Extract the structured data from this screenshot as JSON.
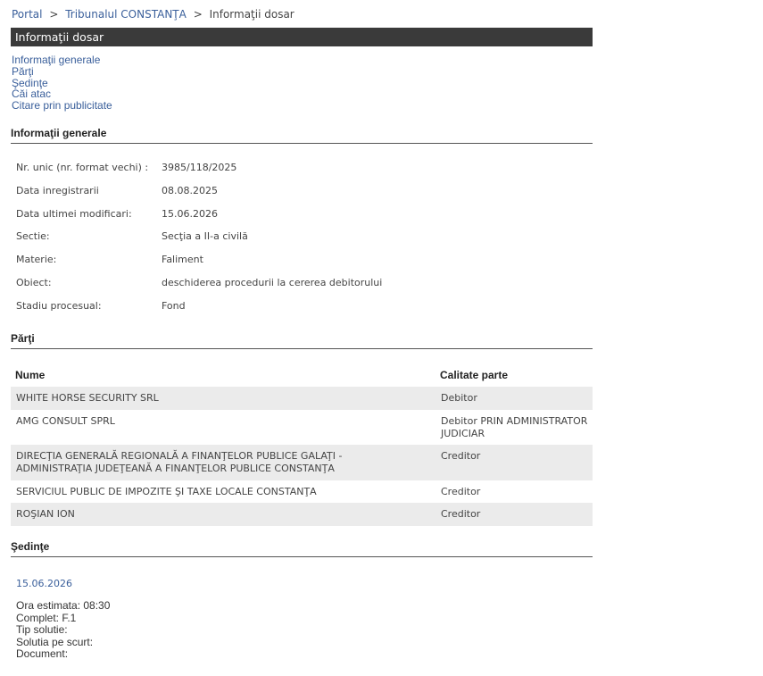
{
  "breadcrumb": {
    "portal": "Portal",
    "sep1": ">",
    "court": "Tribunalul CONSTANŢA",
    "sep2": ">",
    "current": "Informaţii dosar"
  },
  "page_title": "Informaţii dosar",
  "subnav": [
    "Informaţii generale",
    "Părţi",
    "Şedinţe",
    "Căi atac",
    "Citare prin publicitate"
  ],
  "general": {
    "heading": "Informaţii generale",
    "rows": [
      {
        "label": "Nr. unic (nr. format vechi) :",
        "value": "3985/118/2025"
      },
      {
        "label": "Data inregistrarii",
        "value": "08.08.2025"
      },
      {
        "label": "Data ultimei modificari:",
        "value": "15.06.2026"
      },
      {
        "label": "Sectie:",
        "value": "Secţia a II-a civilă"
      },
      {
        "label": "Materie:",
        "value": "Faliment"
      },
      {
        "label": "Obiect:",
        "value": "deschiderea procedurii la cererea debitorului"
      },
      {
        "label": "Stadiu procesual:",
        "value": "Fond"
      }
    ]
  },
  "parti": {
    "heading": "Părţi",
    "col_name": "Nume",
    "col_role": "Calitate parte",
    "rows": [
      {
        "name": "WHITE HORSE SECURITY SRL",
        "role": "Debitor"
      },
      {
        "name": "AMG CONSULT SPRL",
        "role": "Debitor PRIN ADMINISTRATOR JUDICIAR"
      },
      {
        "name": "DIRECŢIA GENERALĂ REGIONALĂ A FINANŢELOR PUBLICE GALAŢI - ADMINISTRAŢIA JUDEŢEANĂ A FINANŢELOR PUBLICE CONSTANŢA",
        "role": "Creditor"
      },
      {
        "name": "SERVICIUL PUBLIC DE IMPOZITE ŞI TAXE LOCALE CONSTANŢA",
        "role": "Creditor"
      },
      {
        "name": "ROŞIAN ION",
        "role": "Creditor"
      }
    ]
  },
  "sedinte": {
    "heading": "Şedinţe",
    "date": "15.06.2026",
    "ora": "Ora estimata: 08:30",
    "complet": "Complet: F.1",
    "tip_solutie": "Tip solutie:",
    "solutia": "Solutia pe scurt:",
    "document": "Document:"
  }
}
